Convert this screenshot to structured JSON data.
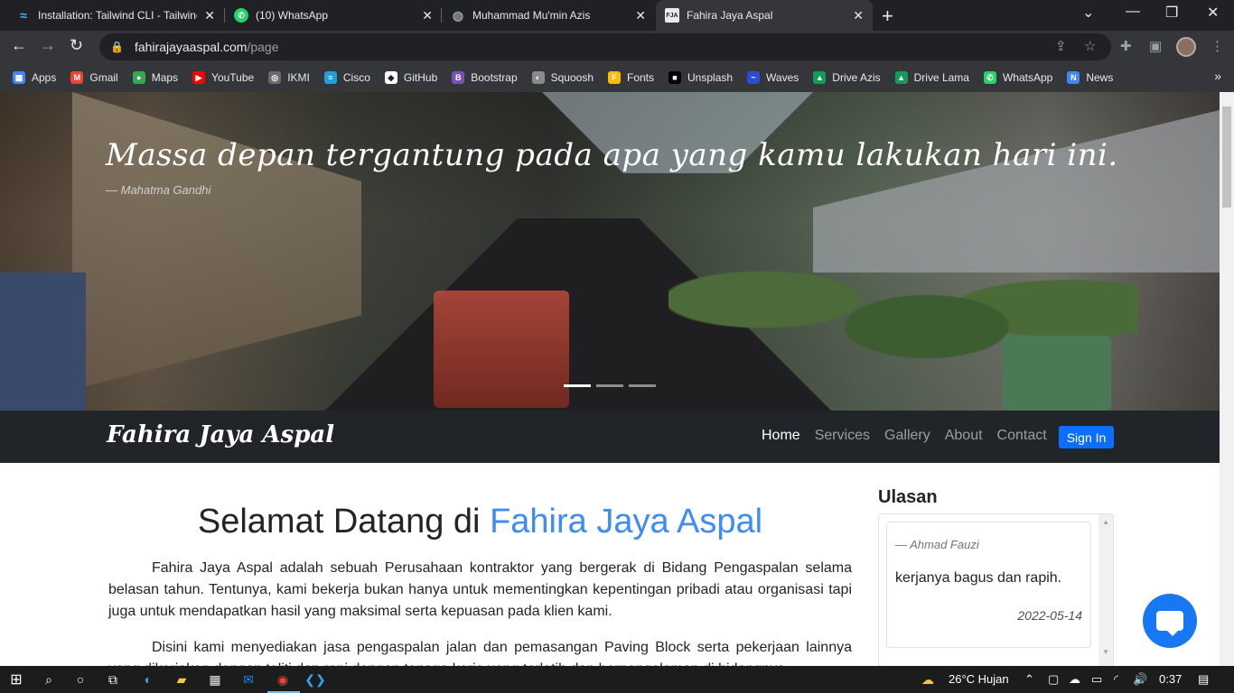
{
  "browser": {
    "tabs": [
      {
        "title": "Installation: Tailwind CLI - Tailwind",
        "icon": "tailwind-icon",
        "color": "#38bdf8",
        "active": false
      },
      {
        "title": "(10) WhatsApp",
        "icon": "whatsapp-icon",
        "color": "#25d366",
        "active": false
      },
      {
        "title": "Muhammad Mu'min Azis",
        "icon": "globe-icon",
        "color": "#9aa0a6",
        "active": false
      },
      {
        "title": "Fahira Jaya Aspal",
        "icon": "fja-icon",
        "color": "#e8eaed",
        "active": true
      }
    ],
    "tab_close": "✕",
    "new_tab": "+",
    "url_host": "fahirajayaaspal.com",
    "url_path": "/page",
    "bookmarks": [
      {
        "label": "Apps",
        "icon": "apps-grid-icon",
        "color": "#4285f4"
      },
      {
        "label": "Gmail",
        "icon": "gmail-icon",
        "color": "#ea4335"
      },
      {
        "label": "Maps",
        "icon": "maps-icon",
        "color": "#34a853"
      },
      {
        "label": "YouTube",
        "icon": "youtube-icon",
        "color": "#ff0000"
      },
      {
        "label": "IKMI",
        "icon": "ikmi-icon",
        "color": "#6a6a6a"
      },
      {
        "label": "Cisco",
        "icon": "cisco-icon",
        "color": "#1ba0d7"
      },
      {
        "label": "GitHub",
        "icon": "github-icon",
        "color": "#ffffff"
      },
      {
        "label": "Bootstrap",
        "icon": "bootstrap-icon",
        "color": "#7952b3"
      },
      {
        "label": "Squoosh",
        "icon": "squoosh-icon",
        "color": "#8a8a8a"
      },
      {
        "label": "Fonts",
        "icon": "fonts-icon",
        "color": "#fbbc04"
      },
      {
        "label": "Unsplash",
        "icon": "unsplash-icon",
        "color": "#000000"
      },
      {
        "label": "Waves",
        "icon": "waves-icon",
        "color": "#2b4cdb"
      },
      {
        "label": "Drive Azis",
        "icon": "drive-icon",
        "color": "#0f9d58"
      },
      {
        "label": "Drive Lama",
        "icon": "drive-icon",
        "color": "#0f9d58"
      },
      {
        "label": "WhatsApp",
        "icon": "whatsapp-icon",
        "color": "#25d366"
      },
      {
        "label": "News",
        "icon": "news-icon",
        "color": "#4285f4"
      }
    ]
  },
  "hero": {
    "quote": "Massa depan tergantung pada apa yang kamu lakukan hari ini.",
    "author": "— Mahatma Gandhi",
    "slides": 3,
    "active_slide": 1
  },
  "site_nav": {
    "brand": "Fahira Jaya Aspal",
    "links": [
      "Home",
      "Services",
      "Gallery",
      "About",
      "Contact"
    ],
    "active_link": "Home",
    "signin": "Sign In",
    "accent": "#0d6efd"
  },
  "main": {
    "title_prefix": "Selamat Datang di",
    "title_accent": "Fahira Jaya Aspal",
    "para1": "Fahira Jaya Aspal adalah sebuah Perusahaan kontraktor yang bergerak di Bidang Pengaspalan selama belasan tahun. Tentunya, kami bekerja bukan hanya untuk mementingkan kepentingan pribadi atau organisasi tapi juga untuk mendapatkan hasil yang maksimal serta kepuasan pada klien kami.",
    "para2": "Disini kami menyediakan jasa pengaspalan jalan dan pemasangan Paving Block serta pekerjaan lainnya yang dikerjakan dengan teliti dan rapi dengan tenaga kerja yang terlatih dan berpengalaman di bidangnya."
  },
  "reviews": {
    "title": "Ulasan",
    "items": [
      {
        "name": "—  Ahmad Fauzi",
        "text": "kerjanya bagus dan rapih.",
        "date": "2022-05-14"
      }
    ]
  },
  "taskbar": {
    "weather": "26°C  Hujan",
    "time": "0:37"
  }
}
